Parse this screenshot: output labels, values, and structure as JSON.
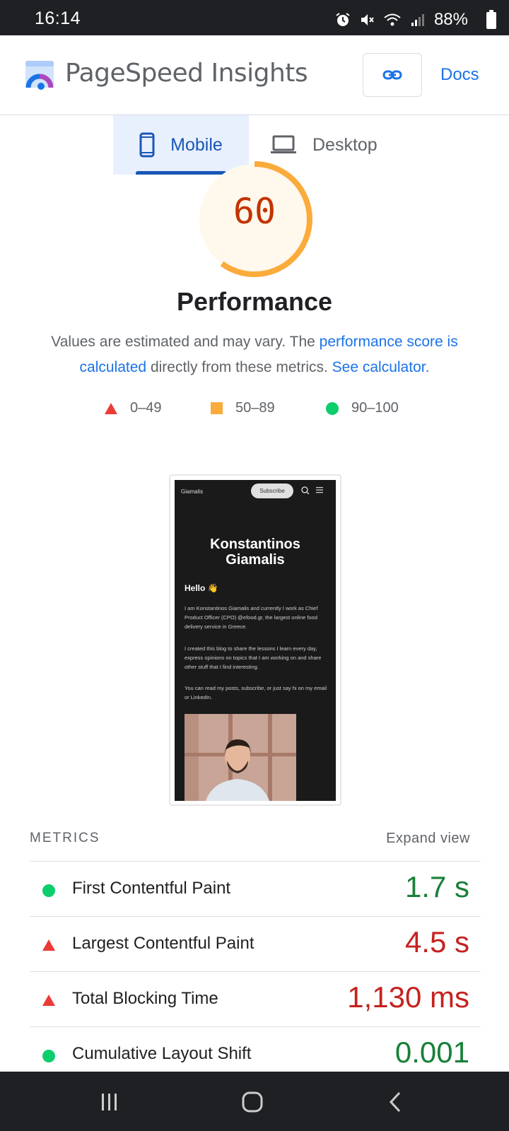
{
  "status_bar": {
    "time": "16:14",
    "battery": "88%",
    "icons": [
      "alarm-icon",
      "mute-icon",
      "wifi-icon",
      "signal-icon",
      "battery-icon"
    ]
  },
  "header": {
    "app_title": "PageSpeed Insights",
    "copy_link_icon": "link-icon",
    "docs_label": "Docs"
  },
  "tabs": [
    {
      "label": "Mobile",
      "icon": "phone-icon",
      "selected": true
    },
    {
      "label": "Desktop",
      "icon": "laptop-icon",
      "selected": false
    }
  ],
  "performance": {
    "score": "60",
    "score_fraction": 0.6,
    "title": "Performance",
    "desc_prefix": "Values are estimated and may vary. The ",
    "desc_link1": "performance score is calculated",
    "desc_middle": " directly from these metrics. ",
    "desc_link2": "See calculator."
  },
  "legend": [
    {
      "shape": "triangle",
      "label": "0–49",
      "color": "#eb3b36"
    },
    {
      "shape": "square",
      "label": "50–89",
      "color": "#fbab3b"
    },
    {
      "shape": "circle",
      "label": "90–100",
      "color": "#0cce6b"
    }
  ],
  "screenshot": {
    "brand": "Giamalis",
    "subscribe": "Subscribe",
    "name_line1": "Konstantinos",
    "name_line2": "Giamalis",
    "hello": "Hello 👋",
    "para1": "I am Konstantinos Giamalis and currently I work as Chief Product Officer (CPO) @efood.gr, the largest online food delivery service in Greece.",
    "para2": "I created this blog to share the lessons I learn every day, express opinions on topics that I am working on and share other stuff that I find interesting.",
    "para3": "You can read my posts, subscribe, or just say hi on my email or LinkedIn."
  },
  "metrics": {
    "heading": "METRICS",
    "expand_label": "Expand view",
    "rows": [
      {
        "name": "First Contentful Paint",
        "value": "1.7 s",
        "rating": "good"
      },
      {
        "name": "Largest Contentful Paint",
        "value": "4.5 s",
        "rating": "poor"
      },
      {
        "name": "Total Blocking Time",
        "value": "1,130 ms",
        "rating": "poor"
      },
      {
        "name": "Cumulative Layout Shift",
        "value": "0.001",
        "rating": "good"
      }
    ]
  },
  "nav_bar": {
    "buttons": [
      "recent-apps-icon",
      "home-icon",
      "back-icon"
    ]
  }
}
